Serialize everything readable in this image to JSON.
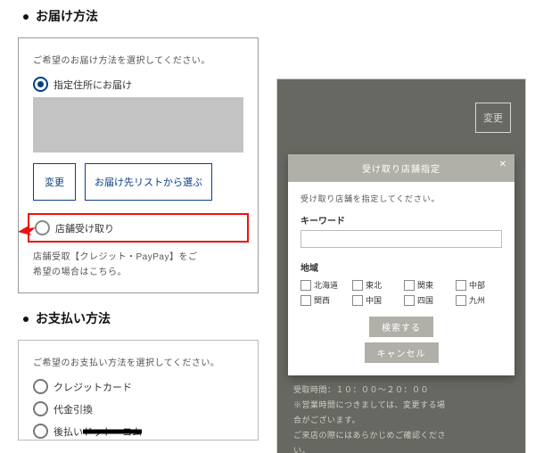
{
  "delivery": {
    "section_title": "お届け方法",
    "instruction": "ご希望のお届け方法を選択してください。",
    "option_address": "指定住所にお届け",
    "change_btn": "変更",
    "pick_from_list_btn": "お届け先リストから選ぶ",
    "option_store": "店舗受け取り",
    "store_note_line1": "店舗受取【クレジット・PayPay】をご",
    "store_note_line2": "希望の場合はこちら。"
  },
  "payment": {
    "section_title": "お支払い方法",
    "instruction": "ご希望のお支払い方法を選択してください。",
    "opt_credit": "クレジットカード",
    "opt_cod": "代金引換",
    "opt_afterpay_prefix": "後払い",
    "opt_afterpay_struck": "ドット・コム"
  },
  "right": {
    "top_change_btn": "変更",
    "modal_title": "受け取り店舗指定",
    "modal_instruction": "受け取り店舗を指定してください。",
    "keyword_label": "キーワード",
    "keyword_placeholder": "",
    "region_label": "地域",
    "regions": [
      "北海道",
      "東北",
      "関東",
      "中部",
      "関西",
      "中国",
      "四国",
      "九州"
    ],
    "search_btn": "検索する",
    "cancel_btn": "キャンセル",
    "back_text_l1": "受取時間：１０：００〜２０：００",
    "back_text_l2": "※営業時間につきましては、変更する場",
    "back_text_l3": "合がございます。",
    "back_text_l4": "ご来店の際にはあらかじめご確認くださ",
    "back_text_l5": "い。"
  }
}
